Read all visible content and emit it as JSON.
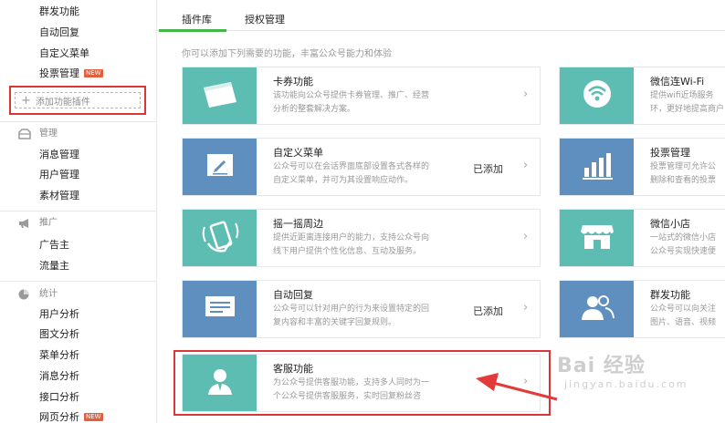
{
  "sidebar": {
    "top_items": [
      {
        "label": "群发功能"
      },
      {
        "label": "自动回复"
      },
      {
        "label": "自定义菜单"
      },
      {
        "label": "投票管理",
        "badge": "NEW"
      }
    ],
    "add_plugin_label": "添加功能插件",
    "sections": [
      {
        "title": "管理",
        "icon": "folder-icon",
        "items": [
          "消息管理",
          "用户管理",
          "素材管理"
        ]
      },
      {
        "title": "推广",
        "icon": "megaphone-icon",
        "items": [
          "广告主",
          "流量主"
        ]
      },
      {
        "title": "统计",
        "icon": "pie-chart-icon",
        "items": [
          "用户分析",
          "图文分析",
          "菜单分析",
          "消息分析",
          "接口分析",
          "网页分析"
        ]
      }
    ],
    "last_item_badge": "NEW"
  },
  "tabs": [
    {
      "label": "插件库",
      "active": true
    },
    {
      "label": "授权管理",
      "active": false
    }
  ],
  "intro": "你可以添加下列需要的功能，丰富公众号能力和体验",
  "plugins_left": [
    {
      "title": "卡券功能",
      "desc1": "该功能向公众号提供卡券管理、推广、经营",
      "desc2": "分析的整套解决方案。",
      "status": "",
      "color": "#5ebdb2",
      "icon": "card-icon"
    },
    {
      "title": "自定义菜单",
      "desc1": "公众号可以在会话界面底部设置各式各样的",
      "desc2": "自定义菜单，并可为其设置响应动作。",
      "status": "已添加",
      "color": "#5e8fbf",
      "icon": "edit-icon"
    },
    {
      "title": "摇一摇周边",
      "desc1": "提供近距离连接用户的能力，支持公众号向",
      "desc2": "线下用户提供个性化信息、互动及服务。",
      "status": "",
      "color": "#5ebdb2",
      "icon": "shake-phone-icon"
    },
    {
      "title": "自动回复",
      "desc1": "公众号可以针对用户的行为来设置特定的回",
      "desc2": "复内容和丰富的关键字回复规则。",
      "status": "已添加",
      "color": "#5e8fbf",
      "icon": "message-icon"
    },
    {
      "title": "客服功能",
      "desc1": "为公众号提供客服功能，支持多人同时为一",
      "desc2": "个公众号提供客服服务，实时回复粉丝咨",
      "status": "",
      "color": "#5ebdb2",
      "icon": "service-person-icon"
    }
  ],
  "plugins_right": [
    {
      "title": "微信连Wi-Fi",
      "desc1": "提供wifi近场服务",
      "desc2": "环，更好地提高商户",
      "color": "#5ebdb2",
      "icon": "wifi-icon"
    },
    {
      "title": "投票管理",
      "desc1": "投票管理可允许公",
      "desc2": "删除和查看的投票",
      "color": "#5e8fbf",
      "icon": "bar-chart-icon"
    },
    {
      "title": "微信小店",
      "desc1": "一站式的微信小店",
      "desc2": "公众号实现快速便",
      "color": "#5ebdb2",
      "icon": "shop-icon"
    },
    {
      "title": "群发功能",
      "desc1": "公众号可以向关注",
      "desc2": "图片、语音、视频",
      "color": "#5e8fbf",
      "icon": "users-icon"
    }
  ],
  "watermark": {
    "main": "Bai  经验",
    "sub": "jingyan.baidu.com"
  },
  "colors": {
    "accent": "#44b549",
    "highlight": "#d93737",
    "teal": "#5ebdb2",
    "blue": "#5e8fbf"
  }
}
